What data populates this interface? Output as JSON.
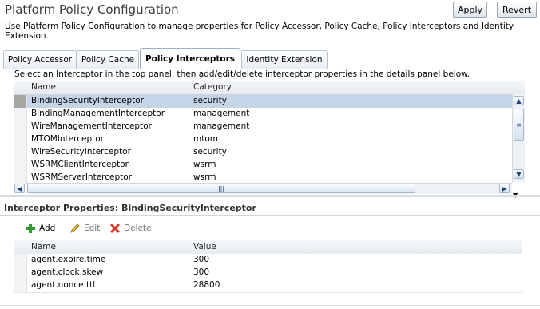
{
  "header": {
    "title": "Platform Policy Configuration",
    "apply_label": "Apply",
    "revert_label": "Revert",
    "description": "Use Platform Policy Configuration to manage properties for Policy Accessor, Policy Cache, Policy Interceptors and Identity Extension."
  },
  "tabs": [
    {
      "label": "Policy Accessor",
      "active": false
    },
    {
      "label": "Policy Cache",
      "active": false
    },
    {
      "label": "Policy Interceptors",
      "active": true
    },
    {
      "label": "Identity Extension",
      "active": false
    }
  ],
  "interceptors": {
    "instruction": "Select an Interceptor in the top panel, then add/edit/delete interceptor properties in the details panel below.",
    "columns": {
      "name": "Name",
      "category": "Category"
    },
    "rows": [
      {
        "name": "BindingSecurityInterceptor",
        "category": "security",
        "selected": true
      },
      {
        "name": "BindingManagementInterceptor",
        "category": "management"
      },
      {
        "name": "WireManagementInterceptor",
        "category": "management"
      },
      {
        "name": "MTOMInterceptor",
        "category": "mtom"
      },
      {
        "name": "WireSecurityInterceptor",
        "category": "security"
      },
      {
        "name": "WSRMClientInterceptor",
        "category": "wsrm"
      },
      {
        "name": "WSRMServerInterceptor",
        "category": "wsrm"
      }
    ]
  },
  "properties": {
    "title": "Interceptor Properties: BindingSecurityInterceptor",
    "toolbar": {
      "add_label": "Add",
      "edit_label": "Edit",
      "delete_label": "Delete"
    },
    "columns": {
      "name": "Name",
      "value": "Value"
    },
    "rows": [
      {
        "name": "agent.expire.time",
        "value": "300"
      },
      {
        "name": "agent.clock.skew",
        "value": "300"
      },
      {
        "name": "agent.nonce.ttl",
        "value": "28800"
      }
    ]
  },
  "colors": {
    "selected_row": "#c6d4e8",
    "accent": "#1d3f73"
  }
}
